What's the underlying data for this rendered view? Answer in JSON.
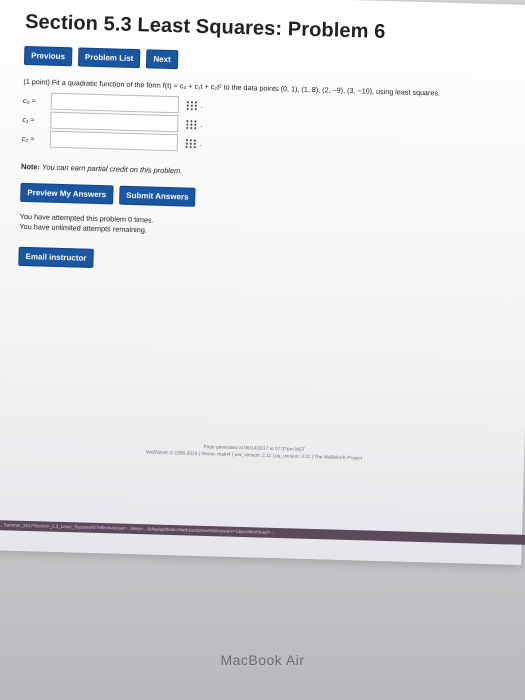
{
  "page": {
    "title": "Section 5.3 Least Squares: Problem 6"
  },
  "nav": {
    "previous": "Previous",
    "problem_list": "Problem List",
    "next": "Next"
  },
  "problem": {
    "text": "(1 point) Fit a quadratic function of the form f(t) = c₀ + c₁t + c₂t² to the data points (0, 1), (1, 8), (2, −9), (3, −10), using least squares.",
    "fields": [
      {
        "label": "c₀ =",
        "value": "",
        "after": "."
      },
      {
        "label": "c₁ =",
        "value": "",
        "after": "."
      },
      {
        "label": "c₂ =",
        "value": "",
        "after": "."
      }
    ]
  },
  "note": {
    "prefix": "Note:",
    "text": " You can earn partial credit on this problem."
  },
  "actions": {
    "preview": "Preview My Answers",
    "submit": "Submit Answers"
  },
  "attempts": {
    "line1": "You have attempted this problem 0 times.",
    "line2": "You have unlimited attempts remaining."
  },
  "email": {
    "label": "Email instructor"
  },
  "footer": {
    "generated": "Page generated at 06/14/2017 at 07:37pm MST",
    "copyright": "WeBWorK © 1996-2016 | theme: math4 | ww_version: 2.11 | pg_version: 2.11 | The WeBWorK Project"
  },
  "urlbar": {
    "text": "...Summer_2017/Section_5.3_Least_Squares/6/?effectiveUser=...&key=...&displayMode=MathJax&showOldAnswers=1&problemSeed=..."
  },
  "device": {
    "brand": "MacBook Air"
  }
}
